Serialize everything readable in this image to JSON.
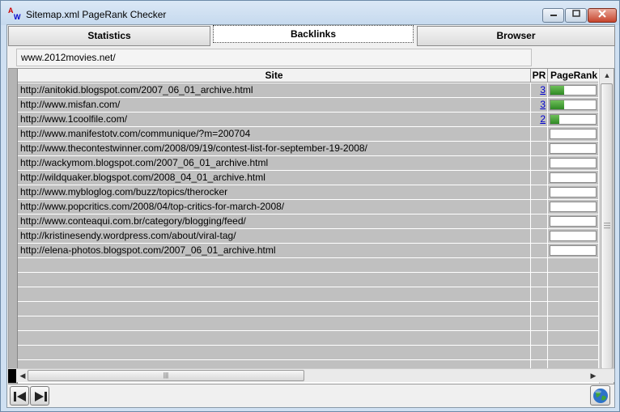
{
  "window": {
    "title": "Sitemap.xml PageRank Checker",
    "buttons": {
      "minimize": "▭",
      "maximize": "□",
      "close": "✕"
    }
  },
  "tabs": [
    {
      "label": "Statistics",
      "active": false
    },
    {
      "label": "Backlinks",
      "active": true
    },
    {
      "label": "Browser",
      "active": false
    }
  ],
  "url_field": {
    "value": "www.2012movies.net/"
  },
  "table": {
    "columns": [
      "Site",
      "PR",
      "PageRank"
    ],
    "rows": [
      {
        "site": "http://anitokid.blogspot.com/2007_06_01_archive.html",
        "pr": "3",
        "rank_fraction": 0.3
      },
      {
        "site": "http://www.misfan.com/",
        "pr": "3",
        "rank_fraction": 0.3
      },
      {
        "site": "http://www.1coolfile.com/",
        "pr": "2",
        "rank_fraction": 0.2
      },
      {
        "site": "http://www.manifestotv.com/communique/?m=200704",
        "pr": "",
        "rank_fraction": 0
      },
      {
        "site": "http://www.thecontestwinner.com/2008/09/19/contest-list-for-september-19-2008/",
        "pr": "",
        "rank_fraction": 0
      },
      {
        "site": "http://wackymom.blogspot.com/2007_06_01_archive.html",
        "pr": "",
        "rank_fraction": 0
      },
      {
        "site": "http://wildquaker.blogspot.com/2008_04_01_archive.html",
        "pr": "",
        "rank_fraction": 0
      },
      {
        "site": "http://www.mybloglog.com/buzz/topics/therocker",
        "pr": "",
        "rank_fraction": 0
      },
      {
        "site": "http://www.popcritics.com/2008/04/top-critics-for-march-2008/",
        "pr": "",
        "rank_fraction": 0
      },
      {
        "site": "http://www.conteaqui.com.br/category/blogging/feed/",
        "pr": "",
        "rank_fraction": 0
      },
      {
        "site": "http://kristinesendy.wordpress.com/about/viral-tag/",
        "pr": "",
        "rank_fraction": 0
      },
      {
        "site": "http://elena-photos.blogspot.com/2007_06_01_archive.html",
        "pr": "",
        "rank_fraction": 0
      }
    ],
    "empty_rows": 8
  },
  "icons": {
    "app": "app-aw-icon",
    "prev": "back-arrow-icon",
    "next": "forward-arrow-icon",
    "globe": "globe-icon"
  },
  "colors": {
    "rank_fill": "#3f9a31",
    "link": "#0000cc",
    "row_bg": "#c0c0c0"
  }
}
